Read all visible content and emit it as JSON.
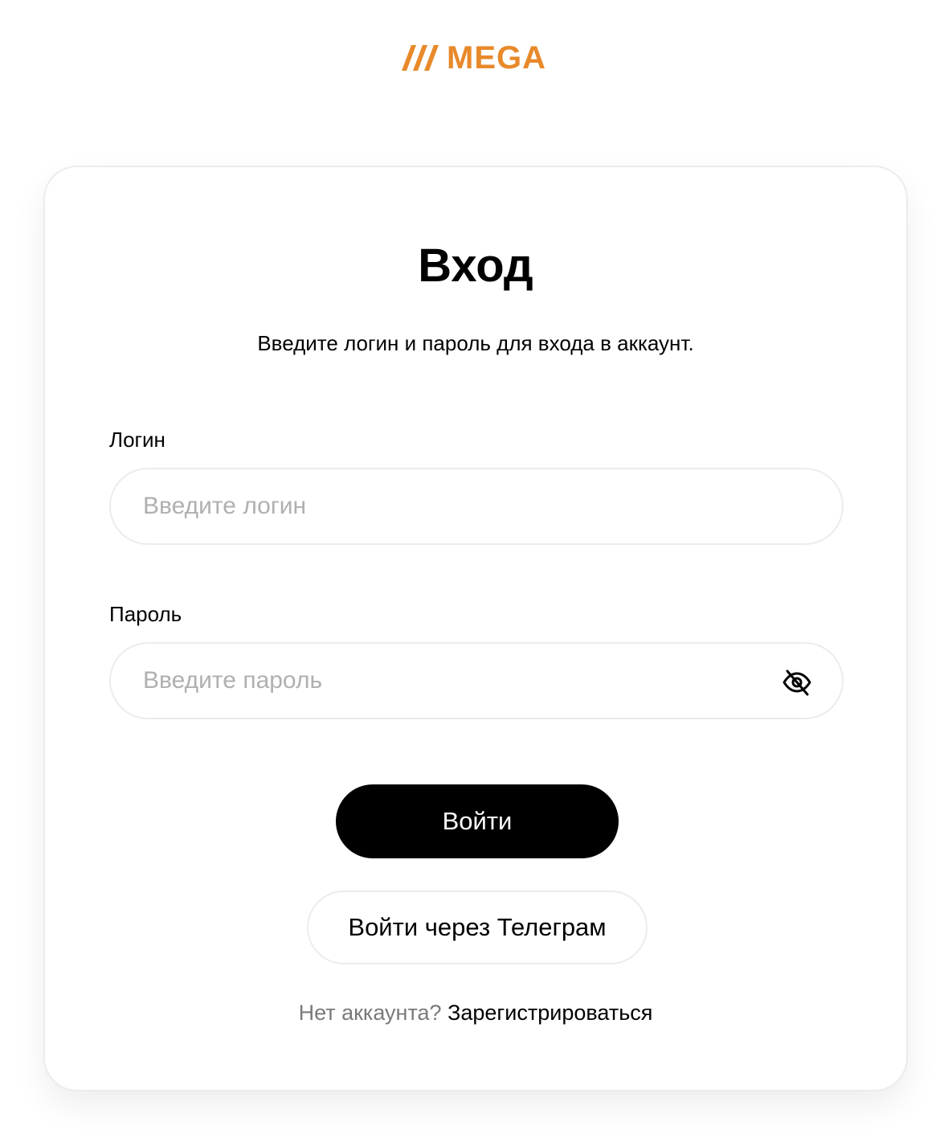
{
  "brand": {
    "name": "MEGA",
    "color": "#E8892A"
  },
  "login_card": {
    "title": "Вход",
    "subtitle": "Введите логин и пароль для входа в аккаунт.",
    "login_field": {
      "label": "Логин",
      "placeholder": "Введите логин",
      "value": ""
    },
    "password_field": {
      "label": "Пароль",
      "placeholder": "Введите пароль",
      "value": "",
      "toggle_icon": "eye-off-icon"
    },
    "submit_button": "Войти",
    "telegram_button": "Войти через Телеграм",
    "signup_prompt": "Нет аккаунта?",
    "signup_link": "Зарегистрироваться"
  },
  "colors": {
    "primary_button_bg": "#000000",
    "border": "#ECECEC",
    "placeholder": "#B0B0B0",
    "muted_text": "#7A7A7A"
  }
}
